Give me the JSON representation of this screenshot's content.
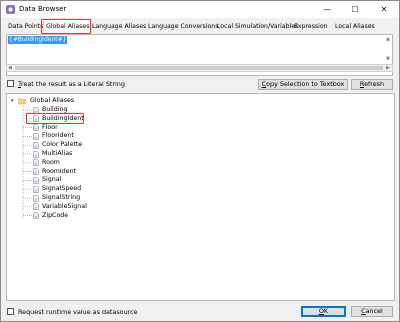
{
  "window": {
    "title": "Data Browser",
    "controls": {
      "minimize": "—",
      "maximize": "☐",
      "close": "✕"
    }
  },
  "tabs": [
    {
      "label": "Data Points"
    },
    {
      "label": "Global Aliases",
      "active": true
    },
    {
      "label": "Language Aliases"
    },
    {
      "label": "Language Conversions"
    },
    {
      "label": "Local Simulation/Variables"
    },
    {
      "label": "Expression"
    },
    {
      "label": "Local Aliases"
    }
  ],
  "editor": {
    "text": "{#BuildingIdent#}"
  },
  "literal_checkbox": {
    "label_prefix": "",
    "label_underline": "T",
    "label_rest": "reat the result as a Literal String",
    "checked": false
  },
  "buttons": {
    "copy_selection_underline": "C",
    "copy_selection_rest": "opy Selection to Textbox",
    "refresh_underline": "R",
    "refresh_rest": "efresh",
    "ok_underline": "O",
    "ok_rest": "K",
    "cancel_underline": "C",
    "cancel_rest": "ancel"
  },
  "tree": {
    "root": "Global Aliases",
    "items": [
      "Building",
      "BuildingIdent",
      "Floor",
      "FloorIdent",
      "Color Palette",
      "MultiAlias",
      "Room",
      "RoomIdent",
      "Signal",
      "SignalSpeed",
      "SignalString",
      "VariableSignal",
      "ZipCode"
    ],
    "selected": "BuildingIdent"
  },
  "runtime_checkbox": {
    "label": "Request runtime value as datasource",
    "checked": false
  },
  "colors": {
    "highlight": "#3399ff",
    "annotation": "#e23a3a",
    "accent": "#0078d7"
  }
}
